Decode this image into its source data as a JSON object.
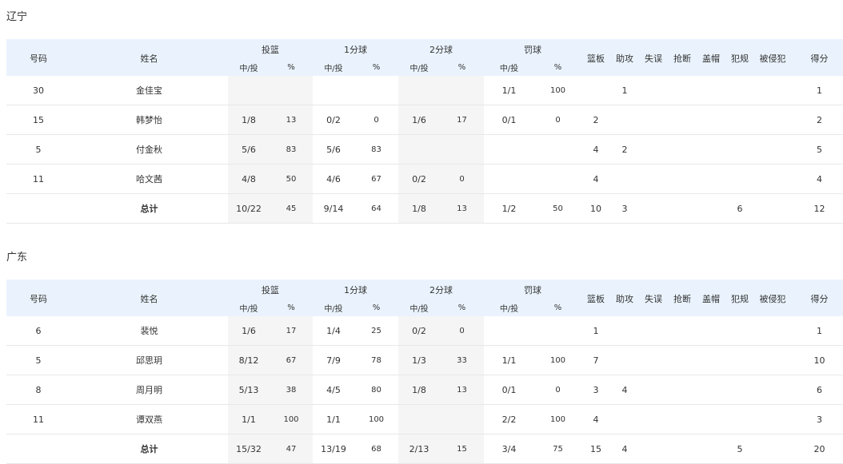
{
  "headers": {
    "number": "号码",
    "name": "姓名",
    "fg": "投篮",
    "p1": "1分球",
    "p2": "2分球",
    "ft": "罚球",
    "made_att": "中/投",
    "pct": "%",
    "reb": "篮板",
    "ast": "助攻",
    "tov": "失误",
    "stl": "抢断",
    "blk": "盖帽",
    "pf": "犯规",
    "fd": "被侵犯",
    "pts": "得分"
  },
  "teams": [
    {
      "name": "辽宁",
      "players": [
        {
          "no": "30",
          "name": "金佳宝",
          "fg": "",
          "fg_pct": "",
          "p1": "",
          "p1_pct": "",
          "p2": "",
          "p2_pct": "",
          "ft": "1/1",
          "ft_pct": "100",
          "reb": "",
          "ast": "1",
          "tov": "",
          "stl": "",
          "blk": "",
          "pf": "",
          "fd": "",
          "pts": "1"
        },
        {
          "no": "15",
          "name": "韩梦怡",
          "fg": "1/8",
          "fg_pct": "13",
          "p1": "0/2",
          "p1_pct": "0",
          "p2": "1/6",
          "p2_pct": "17",
          "ft": "0/1",
          "ft_pct": "0",
          "reb": "2",
          "ast": "",
          "tov": "",
          "stl": "",
          "blk": "",
          "pf": "",
          "fd": "",
          "pts": "2"
        },
        {
          "no": "5",
          "name": "付金秋",
          "fg": "5/6",
          "fg_pct": "83",
          "p1": "5/6",
          "p1_pct": "83",
          "p2": "",
          "p2_pct": "",
          "ft": "",
          "ft_pct": "",
          "reb": "4",
          "ast": "2",
          "tov": "",
          "stl": "",
          "blk": "",
          "pf": "",
          "fd": "",
          "pts": "5"
        },
        {
          "no": "11",
          "name": "哈文茜",
          "fg": "4/8",
          "fg_pct": "50",
          "p1": "4/6",
          "p1_pct": "67",
          "p2": "0/2",
          "p2_pct": "0",
          "ft": "",
          "ft_pct": "",
          "reb": "4",
          "ast": "",
          "tov": "",
          "stl": "",
          "blk": "",
          "pf": "",
          "fd": "",
          "pts": "4"
        }
      ],
      "total": {
        "label": "总计",
        "fg": "10/22",
        "fg_pct": "45",
        "p1": "9/14",
        "p1_pct": "64",
        "p2": "1/8",
        "p2_pct": "13",
        "ft": "1/2",
        "ft_pct": "50",
        "reb": "10",
        "ast": "3",
        "tov": "",
        "stl": "",
        "blk": "",
        "pf": "6",
        "fd": "",
        "pts": "12"
      }
    },
    {
      "name": "广东",
      "players": [
        {
          "no": "6",
          "name": "裴悦",
          "fg": "1/6",
          "fg_pct": "17",
          "p1": "1/4",
          "p1_pct": "25",
          "p2": "0/2",
          "p2_pct": "0",
          "ft": "",
          "ft_pct": "",
          "reb": "1",
          "ast": "",
          "tov": "",
          "stl": "",
          "blk": "",
          "pf": "",
          "fd": "",
          "pts": "1"
        },
        {
          "no": "5",
          "name": "邱思玥",
          "fg": "8/12",
          "fg_pct": "67",
          "p1": "7/9",
          "p1_pct": "78",
          "p2": "1/3",
          "p2_pct": "33",
          "ft": "1/1",
          "ft_pct": "100",
          "reb": "7",
          "ast": "",
          "tov": "",
          "stl": "",
          "blk": "",
          "pf": "",
          "fd": "",
          "pts": "10"
        },
        {
          "no": "8",
          "name": "周月明",
          "fg": "5/13",
          "fg_pct": "38",
          "p1": "4/5",
          "p1_pct": "80",
          "p2": "1/8",
          "p2_pct": "13",
          "ft": "0/1",
          "ft_pct": "0",
          "reb": "3",
          "ast": "4",
          "tov": "",
          "stl": "",
          "blk": "",
          "pf": "",
          "fd": "",
          "pts": "6"
        },
        {
          "no": "11",
          "name": "谭双燕",
          "fg": "1/1",
          "fg_pct": "100",
          "p1": "1/1",
          "p1_pct": "100",
          "p2": "",
          "p2_pct": "",
          "ft": "2/2",
          "ft_pct": "100",
          "reb": "4",
          "ast": "",
          "tov": "",
          "stl": "",
          "blk": "",
          "pf": "",
          "fd": "",
          "pts": "3"
        }
      ],
      "total": {
        "label": "总计",
        "fg": "15/32",
        "fg_pct": "47",
        "p1": "13/19",
        "p1_pct": "68",
        "p2": "2/13",
        "p2_pct": "15",
        "ft": "3/4",
        "ft_pct": "75",
        "reb": "15",
        "ast": "4",
        "tov": "",
        "stl": "",
        "blk": "",
        "pf": "5",
        "fd": "",
        "pts": "20"
      }
    }
  ]
}
